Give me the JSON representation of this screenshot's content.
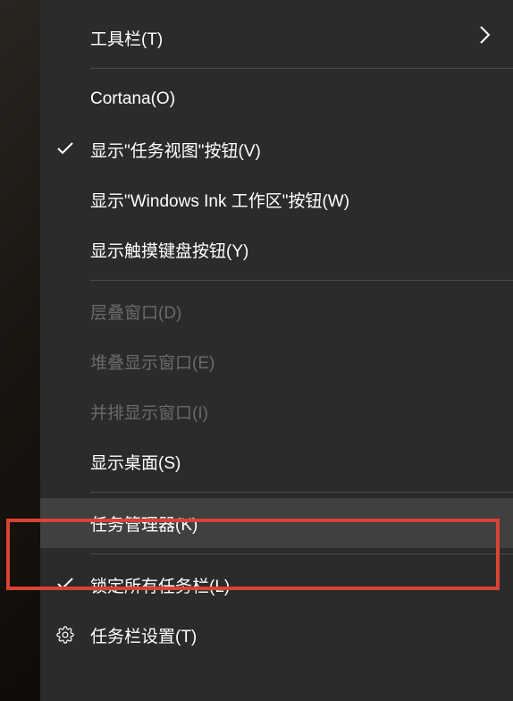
{
  "menu": {
    "items": [
      {
        "label": "工具栏(T)",
        "hasSubmenu": true,
        "checked": false,
        "disabled": false,
        "icon": null
      },
      {
        "label": "Cortana(O)",
        "hasSubmenu": false,
        "checked": false,
        "disabled": false,
        "icon": null
      },
      {
        "label": "显示\"任务视图\"按钮(V)",
        "hasSubmenu": false,
        "checked": true,
        "disabled": false,
        "icon": null
      },
      {
        "label": "显示\"Windows Ink 工作区\"按钮(W)",
        "hasSubmenu": false,
        "checked": false,
        "disabled": false,
        "icon": null
      },
      {
        "label": "显示触摸键盘按钮(Y)",
        "hasSubmenu": false,
        "checked": false,
        "disabled": false,
        "icon": null
      },
      {
        "label": "层叠窗口(D)",
        "hasSubmenu": false,
        "checked": false,
        "disabled": true,
        "icon": null
      },
      {
        "label": "堆叠显示窗口(E)",
        "hasSubmenu": false,
        "checked": false,
        "disabled": true,
        "icon": null
      },
      {
        "label": "并排显示窗口(I)",
        "hasSubmenu": false,
        "checked": false,
        "disabled": true,
        "icon": null
      },
      {
        "label": "显示桌面(S)",
        "hasSubmenu": false,
        "checked": false,
        "disabled": false,
        "icon": null
      },
      {
        "label": "任务管理器(K)",
        "hasSubmenu": false,
        "checked": false,
        "disabled": false,
        "icon": null,
        "hover": true
      },
      {
        "label": "锁定所有任务栏(L)",
        "hasSubmenu": false,
        "checked": true,
        "disabled": false,
        "icon": null
      },
      {
        "label": "任务栏设置(T)",
        "hasSubmenu": false,
        "checked": false,
        "disabled": false,
        "icon": "gear"
      }
    ]
  }
}
